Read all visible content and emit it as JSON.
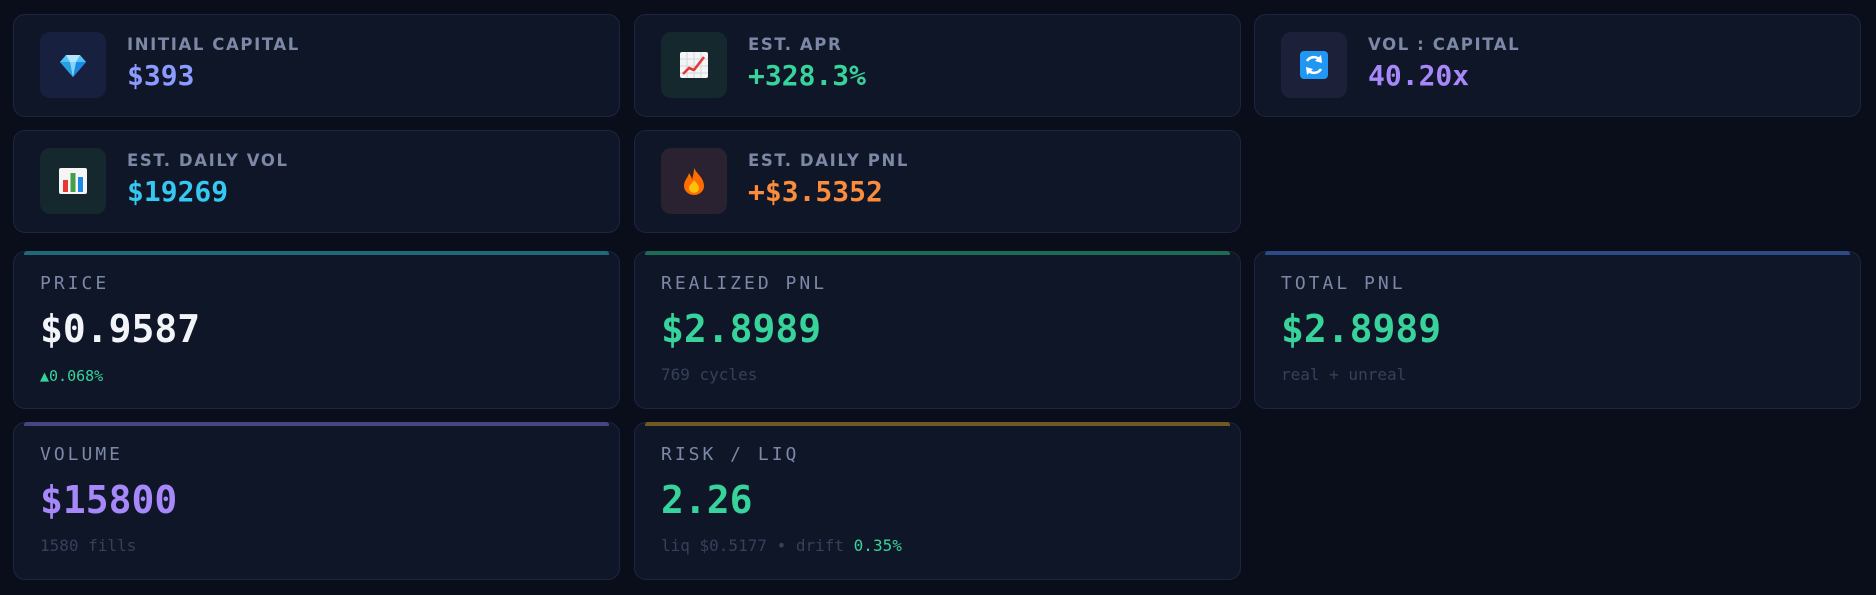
{
  "colors": {
    "background": "#0a0e1a",
    "card": "#0f1628",
    "label": "#7c88a6",
    "muted": "#36405a",
    "blue_value": "#8b9bff",
    "green": "#38d39a",
    "purple": "#a788fa",
    "cyan": "#35c8f0",
    "orange": "#fb8c3c",
    "white": "#f2f4fa"
  },
  "summary": {
    "initial_capital": {
      "label": "INITIAL CAPITAL",
      "value": "$393",
      "icon": "gem-icon"
    },
    "est_apr": {
      "label": "EST. APR",
      "value": "+328.3%",
      "icon": "chart-increasing-icon"
    },
    "vol_capital": {
      "label": "VOL : CAPITAL",
      "value": "40.20x",
      "icon": "refresh-arrows-icon"
    },
    "est_daily_vol": {
      "label": "EST. DAILY VOL",
      "value": "$19269",
      "icon": "bar-chart-icon"
    },
    "est_daily_pnl": {
      "label": "EST. DAILY PNL",
      "value": "+$3.5352",
      "icon": "fire-icon"
    }
  },
  "metrics": {
    "price": {
      "label": "PRICE",
      "value": "$0.9587",
      "change": "▲0.068%"
    },
    "realized_pnl": {
      "label": "REALIZED PNL",
      "value": "$2.8989",
      "sub": "769 cycles"
    },
    "total_pnl": {
      "label": "TOTAL PNL",
      "value": "$2.8989",
      "sub": "real + unreal"
    },
    "volume": {
      "label": "VOLUME",
      "value": "$15800",
      "sub": "1580 fills"
    },
    "risk_liq": {
      "label": "RISK / LIQ",
      "value": "2.26",
      "sub_prefix": "liq $0.5177 • drift",
      "drift": "0.35%"
    }
  }
}
